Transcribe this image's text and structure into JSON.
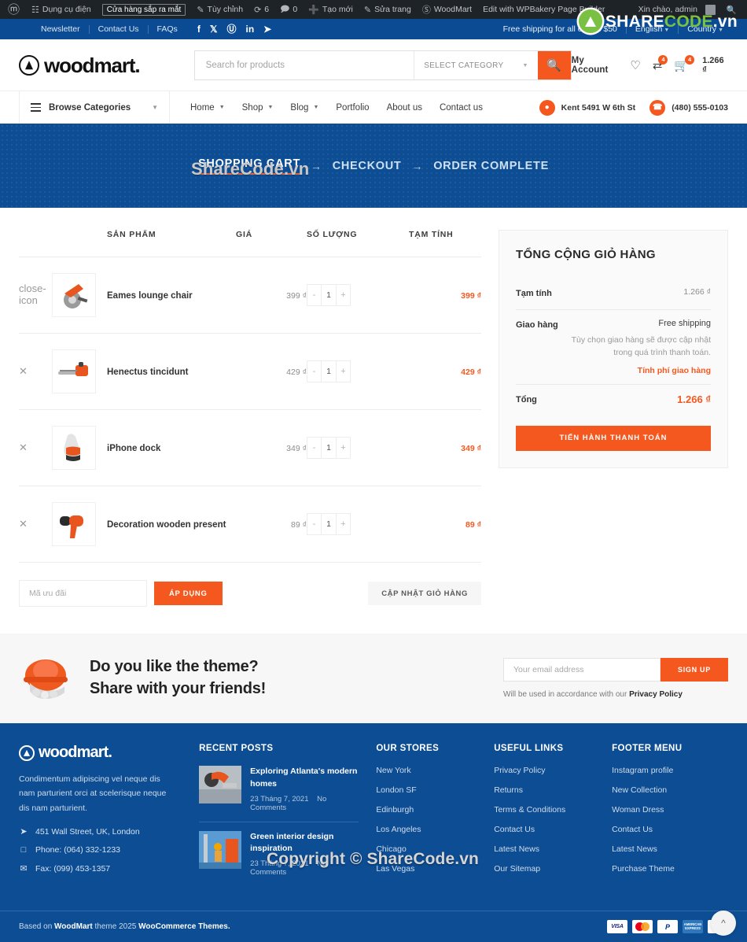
{
  "admin_bar": {
    "logo_icon": "wordpress-icon",
    "items": [
      {
        "icon": "dashboard-icon",
        "label": "Dụng cụ điện"
      },
      {
        "icon": "",
        "label": "Cửa hàng sắp ra mắt",
        "pill": true
      },
      {
        "icon": "pencil-icon",
        "label": "Tùy chỉnh"
      },
      {
        "icon": "updates-icon",
        "label": "6"
      },
      {
        "icon": "comments-icon",
        "label": "0"
      },
      {
        "icon": "plus-icon",
        "label": "Tạo mới"
      },
      {
        "icon": "edit-icon",
        "label": "Sửa trang"
      },
      {
        "icon": "woodmart-icon",
        "label": "WoodMart"
      },
      {
        "icon": "",
        "label": "Edit with WPBakery Page Builder"
      }
    ],
    "greeting": "Xin chào, admin",
    "search_icon": "search-icon"
  },
  "topbar": {
    "links": [
      "Newsletter",
      "Contact Us",
      "FAQs"
    ],
    "socials": [
      "facebook-icon",
      "x-icon",
      "pinterest-icon",
      "linkedin-icon",
      "telegram-icon"
    ],
    "shipping_note": "Free shipping for all orders $50",
    "language": "English",
    "country": "Country"
  },
  "header": {
    "logo_text": "woodmart.",
    "search": {
      "placeholder": "Search for products",
      "category": "SELECT CATEGORY",
      "button_icon": "search-icon"
    },
    "my_account": "My Account",
    "wishlist_icon": "heart-icon",
    "compare_icon": "compare-icon",
    "compare_count": "4",
    "cart_icon": "cart-icon",
    "cart_count": "4",
    "cart_total": "1.266 ₫"
  },
  "nav": {
    "browse_label": "Browse Categories",
    "menu": [
      "Home",
      "Shop",
      "Blog",
      "Portfolio",
      "About us",
      "Contact us"
    ],
    "address_icon": "map-pin-icon",
    "address": "Kent 5491 W 6th St",
    "phone_icon": "phone-icon",
    "phone": "(480) 555-0103"
  },
  "hero": {
    "steps": [
      "SHOPPING CART",
      "CHECKOUT",
      "ORDER COMPLETE"
    ],
    "arrow": "→",
    "active_index": 0
  },
  "cart": {
    "headers": {
      "remove": "",
      "thumb": "",
      "product": "SẢN PHẨM",
      "price": "GIÁ",
      "quantity": "SỐ LƯỢNG",
      "subtotal": "TẠM TÍNH"
    },
    "rows": [
      {
        "name": "Eames lounge chair",
        "price": "399 ₫",
        "qty": "1",
        "subtotal": "399 ₫",
        "thumb": "circular-saw"
      },
      {
        "name": "Henectus tincidunt",
        "price": "429 ₫",
        "qty": "1",
        "subtotal": "429 ₫",
        "thumb": "chainsaw"
      },
      {
        "name": "iPhone dock",
        "price": "349 ₫",
        "qty": "1",
        "subtotal": "349 ₫",
        "thumb": "work-glove"
      },
      {
        "name": "Decoration wooden present",
        "price": "89 ₫",
        "qty": "1",
        "subtotal": "89 ₫",
        "thumb": "heat-gun"
      }
    ],
    "remove_icon": "close-icon",
    "minus_label": "-",
    "plus_label": "+",
    "coupon_placeholder": "Mã ưu đãi",
    "apply_label": "ÁP DỤNG",
    "update_label": "CẬP NHẬT GIỎ HÀNG"
  },
  "totals": {
    "title": "TỔNG CỘNG GIỎ HÀNG",
    "subtotal_label": "Tạm tính",
    "subtotal_value": "1.266 ₫",
    "shipping_label": "Giao hàng",
    "shipping_method": "Free shipping",
    "shipping_note": "Tùy chọn giao hàng sẽ được cập nhật trong quá trình thanh toán.",
    "shipping_link": "Tính phí giao hàng",
    "total_label": "Tổng",
    "total_value": "1.266 ₫",
    "checkout_label": "TIẾN HÀNH THANH TOÁN"
  },
  "promo": {
    "icon": "safety-helmet",
    "line1": "Do you like the theme?",
    "line2": "Share with your friends!",
    "email_placeholder": "Your email address",
    "signup_label": "SIGN UP",
    "note_prefix": "Will be used in accordance with our ",
    "note_link": "Privacy Policy"
  },
  "footer": {
    "logo_text": "woodmart.",
    "description": "Condimentum adipiscing vel neque dis nam parturient orci at scelerisque neque dis nam parturient.",
    "contact": [
      {
        "icon": "location-arrow-icon",
        "text": "451 Wall Street, UK, London"
      },
      {
        "icon": "mobile-icon",
        "text": "Phone: (064) 332-1233"
      },
      {
        "icon": "envelope-icon",
        "text": "Fax: (099) 453-1357"
      }
    ],
    "recent_posts_title": "RECENT POSTS",
    "posts": [
      {
        "title": "Exploring Atlanta's modern homes",
        "date": "23 Tháng 7, 2021",
        "comments": "No Comments",
        "thumb": "motorcycle"
      },
      {
        "title": "Green interior design inspiration",
        "date": "23 Tháng 7, 2021",
        "comments": "No Comments",
        "thumb": "crane-worker"
      }
    ],
    "stores_title": "OUR STORES",
    "stores": [
      "New York",
      "London SF",
      "Edinburgh",
      "Los Angeles",
      "Chicago",
      "Las Vegas"
    ],
    "useful_title": "USEFUL LINKS",
    "useful": [
      "Privacy Policy",
      "Returns",
      "Terms & Conditions",
      "Contact Us",
      "Latest News",
      "Our Sitemap"
    ],
    "menu_title": "FOOTER MENU",
    "menu": [
      "Instagram profile",
      "New Collection",
      "Woman Dress",
      "Contact Us",
      "Latest News",
      "Purchase Theme"
    ],
    "copyright_prefix": "Based on ",
    "copyright_brand": "WoodMart",
    "copyright_mid": " theme 2025 ",
    "copyright_suffix": "WooCommerce Themes.",
    "payments": [
      "VISA",
      "MasterCard",
      "PayPal",
      "American Express",
      "VISA Electron"
    ],
    "scroll_top_icon": "chevron-up-icon"
  },
  "watermark": {
    "logo_share": "SHARE",
    "logo_code": "CODE",
    "logo_vn": ".vn",
    "hero_text": "ShareCode.vn",
    "copyright_text": "Copyright © ShareCode.vn"
  },
  "colors": {
    "accent": "#f4581f",
    "brand_blue": "#0d4d94",
    "topbar_blue": "#0a4b94",
    "admin_dark": "#1d2327",
    "watermark_green": "#7ac143"
  }
}
